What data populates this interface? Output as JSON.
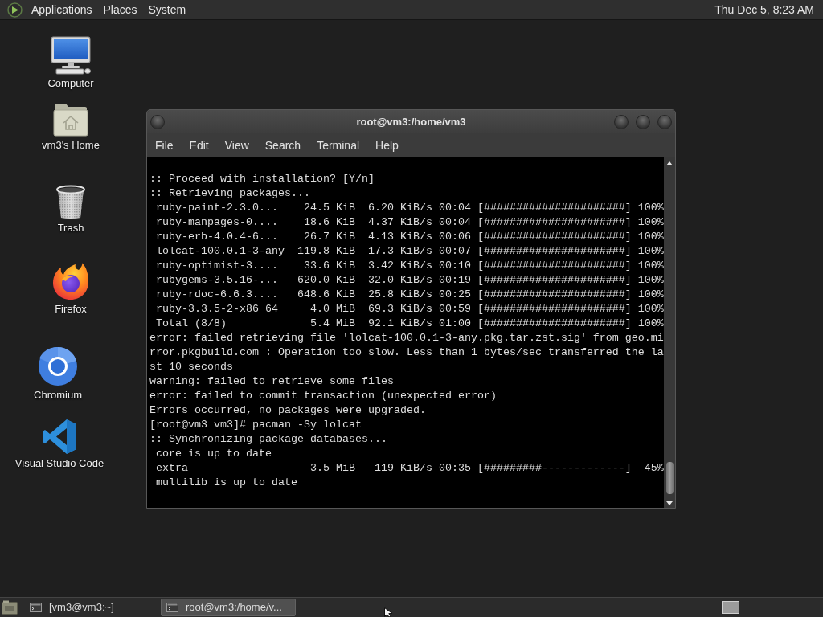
{
  "top_panel": {
    "menus": [
      "Applications",
      "Places",
      "System"
    ],
    "clock": "Thu Dec 5, 8:23 AM"
  },
  "desktop_icons": [
    {
      "label": "Computer",
      "kind": "computer"
    },
    {
      "label": "vm3's Home",
      "kind": "home"
    },
    {
      "label": "Trash",
      "kind": "trash"
    },
    {
      "label": "Firefox",
      "kind": "firefox"
    },
    {
      "label": "Chromium",
      "kind": "chromium"
    },
    {
      "label": "Visual Studio Code",
      "kind": "vscode"
    }
  ],
  "window": {
    "title": "root@vm3:/home/vm3",
    "menu": [
      "File",
      "Edit",
      "View",
      "Search",
      "Terminal",
      "Help"
    ],
    "terminal_lines": [
      ":: Proceed with installation? [Y/n]",
      ":: Retrieving packages...",
      " ruby-paint-2.3.0...    24.5 KiB  6.20 KiB/s 00:04 [######################] 100%",
      " ruby-manpages-0....    18.6 KiB  4.37 KiB/s 00:04 [######################] 100%",
      " ruby-erb-4.0.4-6...    26.7 KiB  4.13 KiB/s 00:06 [######################] 100%",
      " lolcat-100.0.1-3-any  119.8 KiB  17.3 KiB/s 00:07 [######################] 100%",
      " ruby-optimist-3....    33.6 KiB  3.42 KiB/s 00:10 [######################] 100%",
      " rubygems-3.5.16-...   620.0 KiB  32.0 KiB/s 00:19 [######################] 100%",
      " ruby-rdoc-6.6.3....   648.6 KiB  25.8 KiB/s 00:25 [######################] 100%",
      " ruby-3.3.5-2-x86_64     4.0 MiB  69.3 KiB/s 00:59 [######################] 100%",
      " Total (8/8)             5.4 MiB  92.1 KiB/s 01:00 [######################] 100%",
      "error: failed retrieving file 'lolcat-100.0.1-3-any.pkg.tar.zst.sig' from geo.mi",
      "rror.pkgbuild.com : Operation too slow. Less than 1 bytes/sec transferred the la",
      "st 10 seconds",
      "warning: failed to retrieve some files",
      "error: failed to commit transaction (unexpected error)",
      "Errors occurred, no packages were upgraded.",
      "[root@vm3 vm3]# pacman -Sy lolcat",
      ":: Synchronizing package databases...",
      " core is up to date",
      " extra                   3.5 MiB   119 KiB/s 00:35 [#########-------------]  45%",
      " multilib is up to date"
    ]
  },
  "taskbar": {
    "tasks": [
      {
        "label": "[vm3@vm3:~]",
        "selected": false
      },
      {
        "label": "root@vm3:/home/v...",
        "selected": true
      }
    ]
  }
}
